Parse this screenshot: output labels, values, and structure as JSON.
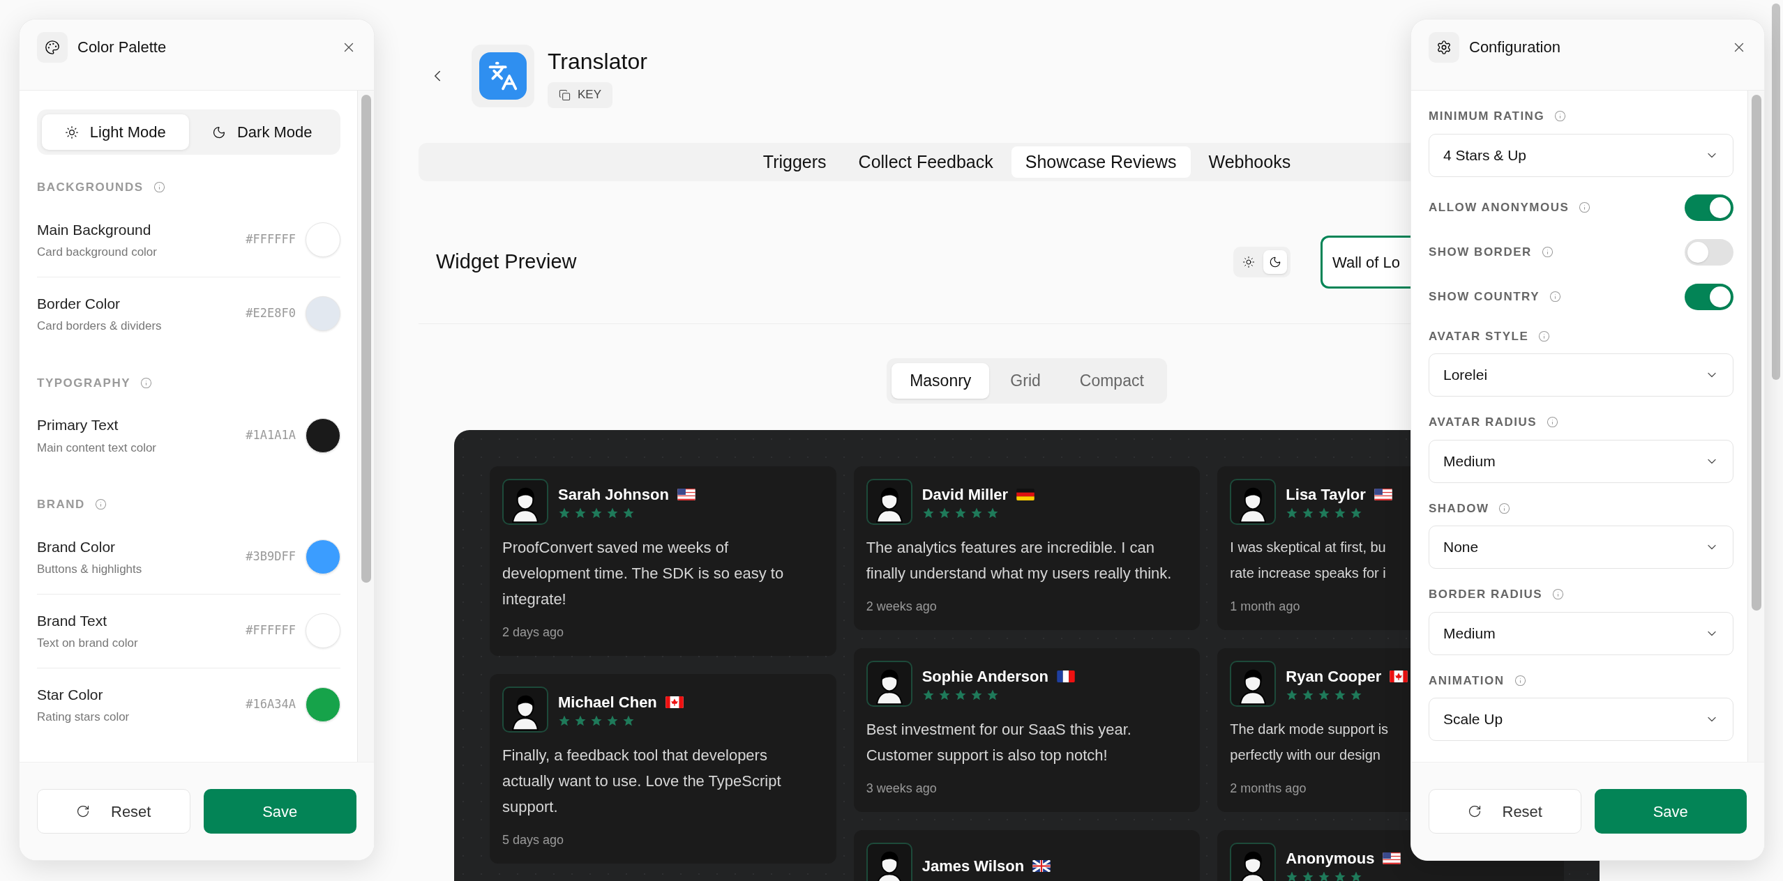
{
  "app": {
    "name": "Translator",
    "key_label": "KEY"
  },
  "tabs": [
    {
      "label": "Triggers",
      "selected": false
    },
    {
      "label": "Collect Feedback",
      "selected": false
    },
    {
      "label": "Showcase Reviews",
      "selected": true
    },
    {
      "label": "Webhooks",
      "selected": false
    }
  ],
  "preview": {
    "title": "Widget Preview",
    "themes": [
      {
        "kind": "light",
        "selected": false
      },
      {
        "kind": "dark",
        "selected": true
      }
    ],
    "layout_select": "Wall of Lo",
    "layouts": [
      {
        "label": "Masonry",
        "selected": true
      },
      {
        "label": "Grid",
        "selected": false
      },
      {
        "label": "Compact",
        "selected": false
      }
    ],
    "columns": [
      [
        {
          "name": "Sarah Johnson",
          "kind": "us",
          "stars": 5,
          "text": "ProofConvert saved me weeks of development time. The SDK is so easy to integrate!",
          "time": "2 days ago"
        },
        {
          "name": "Michael Chen",
          "kind": "ca",
          "stars": 5,
          "text": "Finally, a feedback tool that developers actually want to use. Love the TypeScript support.",
          "time": "5 days ago"
        }
      ],
      [
        {
          "name": "David Miller",
          "kind": "de",
          "stars": 5,
          "text": "The analytics features are incredible. I can finally understand what my users really think.",
          "time": "2 weeks ago"
        },
        {
          "name": "Sophie Anderson",
          "kind": "fr",
          "stars": 5,
          "text": "Best investment for our SaaS this year. Customer support is also top notch!",
          "time": "3 weeks ago"
        },
        {
          "name": "James Wilson",
          "kind": "gb"
        }
      ],
      [
        {
          "name": "Lisa Taylor",
          "kind": "us",
          "stars": 5,
          "lines": [
            "I was skeptical at first, bu",
            "rate increase speaks for i"
          ],
          "time": "1 month ago"
        },
        {
          "name": "Ryan Cooper",
          "kind": "ca",
          "stars": 5,
          "lines": [
            "The dark mode support is",
            "perfectly with our design"
          ],
          "time": "2 months ago"
        },
        {
          "name": "Anonymous",
          "kind": "us",
          "stars": 5
        }
      ]
    ]
  },
  "color_palette": {
    "title": "Color Palette",
    "modes": [
      {
        "kind": "light",
        "label": "Light Mode",
        "selected": true
      },
      {
        "kind": "dark",
        "label": "Dark Mode",
        "selected": false
      }
    ],
    "sections": [
      {
        "title": "BACKGROUNDS",
        "items": [
          {
            "name": "Main Background",
            "description": "Card background color",
            "hex": "#FFFFFF",
            "color": "#ffffff"
          },
          {
            "name": "Border Color",
            "description": "Card borders & dividers",
            "hex": "#E2E8F0",
            "color": "#e2e8f0"
          }
        ]
      },
      {
        "title": "TYPOGRAPHY",
        "items": [
          {
            "name": "Primary Text",
            "description": "Main content text color",
            "hex": "#1A1A1A",
            "color": "#1a1a1a"
          }
        ]
      },
      {
        "title": "BRAND",
        "items": [
          {
            "name": "Brand Color",
            "description": "Buttons & highlights",
            "hex": "#3B9DFF",
            "color": "#3b9dff"
          },
          {
            "name": "Brand Text",
            "description": "Text on brand color",
            "hex": "#FFFFFF",
            "color": "#ffffff"
          },
          {
            "name": "Star Color",
            "description": "Rating stars color",
            "hex": "#16A34A",
            "color": "#16a34a"
          }
        ]
      }
    ],
    "reset_label": "Reset",
    "save_label": "Save"
  },
  "configuration": {
    "title": "Configuration",
    "fields": [
      {
        "kind": "select",
        "label": "MINIMUM RATING",
        "value": "4 Stars & Up"
      },
      {
        "kind": "toggle",
        "label": "ALLOW ANONYMOUS",
        "on": true
      },
      {
        "kind": "toggle",
        "label": "SHOW BORDER",
        "on": false
      },
      {
        "kind": "toggle",
        "label": "SHOW COUNTRY",
        "on": true
      },
      {
        "kind": "select",
        "label": "AVATAR STYLE",
        "value": "Lorelei"
      },
      {
        "kind": "select",
        "label": "AVATAR RADIUS",
        "value": "Medium"
      },
      {
        "kind": "select",
        "label": "SHADOW",
        "value": "None"
      },
      {
        "kind": "select",
        "label": "BORDER RADIUS",
        "value": "Medium"
      },
      {
        "kind": "select",
        "label": "ANIMATION",
        "value": "Scale Up"
      }
    ],
    "reset_label": "Reset",
    "save_label": "Save"
  }
}
